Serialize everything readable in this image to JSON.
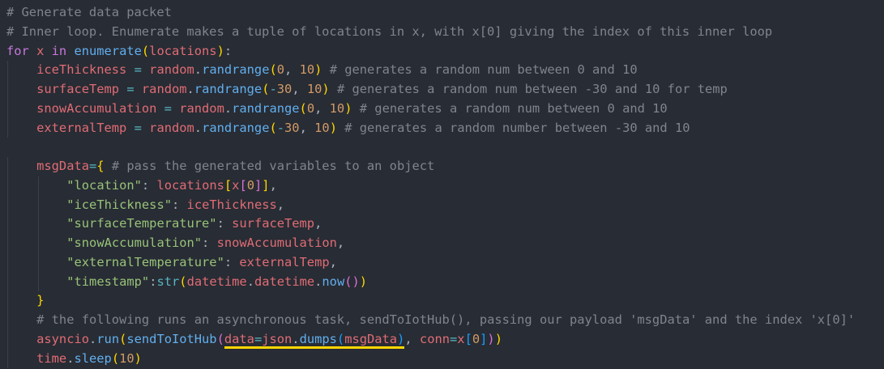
{
  "editor": {
    "lines": [
      "# Generate data packet",
      "# Inner loop. Enumerate makes a tuple of locations in x, with x[0] giving the index of this inner loop",
      "for x in enumerate(locations):",
      "    iceThickness = random.randrange(0, 10) # generates a random num between 0 and 10",
      "    surfaceTemp = random.randrange(-30, 10) # generates a random num between -30 and 10 for temp",
      "    snowAccumulation = random.randrange(0, 10) # generates a random num between 0 and 10",
      "    externalTemp = random.randrange(-30, 10) # generates a random number between -30 and 10",
      "",
      "    msgData={ # pass the generated variables to an object",
      "        \"location\": locations[x[0]],",
      "        \"iceThickness\": iceThickness,",
      "        \"surfaceTemperature\": surfaceTemp,",
      "        \"snowAccumulation\": snowAccumulation,",
      "        \"externalTemperature\": externalTemp,",
      "        \"timestamp\":str(datetime.datetime.now())",
      "    }",
      "    # the following runs an asynchronous task, sendToIotHub(), passing our payload 'msgData' and the index 'x[0]'",
      "    asyncio.run(sendToIotHub(data=json.dumps(msgData), conn=x[0]))",
      "    time.sleep(10)"
    ],
    "highlighted_text": "data=json.dumps(msgData)",
    "colors": {
      "background": "#282c34",
      "comment": "#7f848e",
      "keyword": "#c678dd",
      "function": "#61afef",
      "variable": "#e06c75",
      "operator": "#56b6c2",
      "number": "#d19a66",
      "string": "#98c379",
      "plain": "#abb2bf",
      "highlight_underline": "#ffd700"
    }
  }
}
